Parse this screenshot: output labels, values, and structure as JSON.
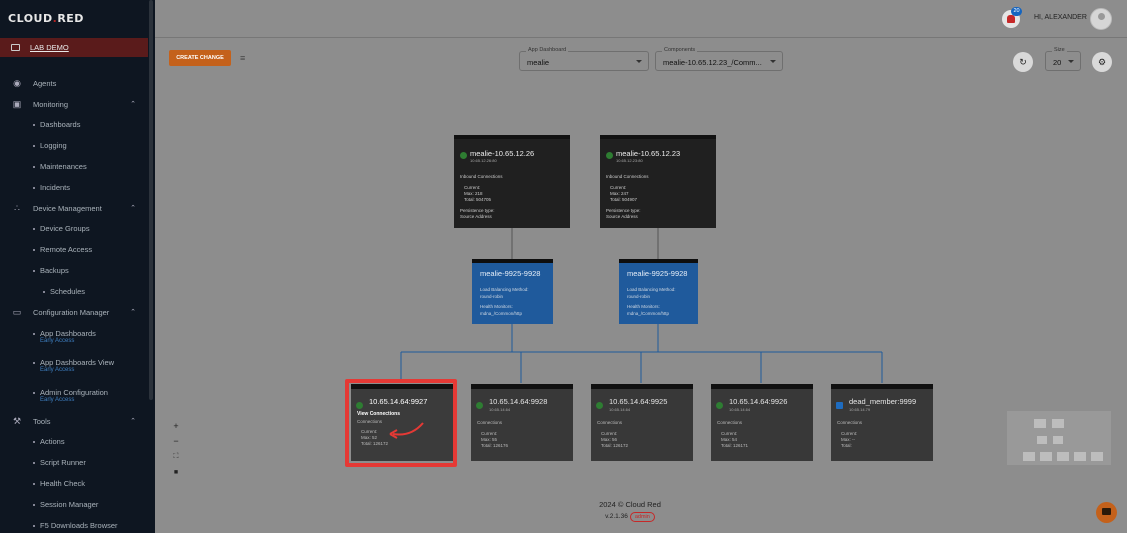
{
  "brand": {
    "logo_left": "CL",
    "logo_mid": "OUD",
    "logo_dot": ".",
    "logo_right": "RED"
  },
  "sidebar": {
    "workspace": "LAB DEMO",
    "items": [
      {
        "label": "Agents"
      },
      {
        "label": "Monitoring"
      },
      {
        "label": "Device Management"
      },
      {
        "label": "Configuration Manager"
      },
      {
        "label": "Tools"
      }
    ],
    "monitoring_sub": [
      "Dashboards",
      "Logging",
      "Maintenances",
      "Incidents"
    ],
    "device_sub": [
      "Device Groups",
      "Remote Access",
      "Backups",
      "Schedules"
    ],
    "config_sub": [
      {
        "label": "App Dashboards",
        "tag": "Early Access"
      },
      {
        "label": "App Dashboards View",
        "tag": "Early Access"
      },
      {
        "label": "Admin Configuration",
        "tag": "Early Access"
      }
    ],
    "tools_sub": [
      "Actions",
      "Script Runner",
      "Health Check",
      "Session Manager",
      "F5 Downloads Browser"
    ]
  },
  "header": {
    "greeting": "HI, ALEXANDER",
    "notifications": "20"
  },
  "toolbar": {
    "create_change": "CREATE CHANGE",
    "app_dashboard_label": "App Dashboard",
    "app_dashboard_value": "mealie",
    "components_label": "Components",
    "components_value": "mealie-10.65.12.23_/Comm...",
    "size_label": "Size",
    "size_value": "20"
  },
  "vservers": [
    {
      "title": "mealie-10.65.12.26",
      "ip": "10.65.12.26:80",
      "inbound": "Inbound Connections",
      "current": "Current:",
      "max": "Max:   218",
      "total": "Total:   504705",
      "persistence": "Persistence type:",
      "source": "Source Address"
    },
    {
      "title": "mealie-10.65.12.23",
      "ip": "10.65.12.23:80",
      "inbound": "Inbound Connections",
      "current": "Current:",
      "max": "Max:   247",
      "total": "Total:   504907",
      "persistence": "Persistence type:",
      "source": "Source Address"
    }
  ],
  "pools": [
    {
      "title": "mealie-9925-9928",
      "method": "Load Balancing Method:",
      "method_val": "round-robin",
      "monitors": "Health Monitors:",
      "monitors_val": "mdna_/Common/http"
    },
    {
      "title": "mealie-9925-9928",
      "method": "Load Balancing Method:",
      "method_val": "round-robin",
      "monitors": "Health Monitors:",
      "monitors_val": "mdna_/Common/http"
    }
  ],
  "members": [
    {
      "title": "10.65.14.64:9927",
      "ip": "10.65.14.64",
      "link": "View Connections",
      "conn": "Connections",
      "current": "Current:",
      "max": "Max:   52",
      "total": "Total:   126172"
    },
    {
      "title": "10.65.14.64:9928",
      "ip": "10.65.14.64",
      "conn": "Connections",
      "current": "Current:",
      "max": "Max:   55",
      "total": "Total:   126176"
    },
    {
      "title": "10.65.14.64:9925",
      "ip": "10.65.14.64",
      "conn": "Connections",
      "current": "Current:",
      "max": "Max:   56",
      "total": "Total:   126172"
    },
    {
      "title": "10.65.14.64:9926",
      "ip": "10.65.14.64",
      "conn": "Connections",
      "current": "Current:",
      "max": "Max:   54",
      "total": "Total:   126171"
    },
    {
      "title": "dead_member:9999",
      "ip": "10.65.14.79",
      "conn": "Connections",
      "current": "Current:",
      "max": "Max:   --",
      "total": "Total:"
    }
  ],
  "footer": {
    "copyright": "2024 © Cloud Red",
    "version": "v.2.1.36",
    "role": "admin"
  },
  "colors": {
    "accent": "#c4611b",
    "brand_red": "#b02020",
    "pool_blue": "#1f5a9c",
    "highlight": "#e53935"
  }
}
